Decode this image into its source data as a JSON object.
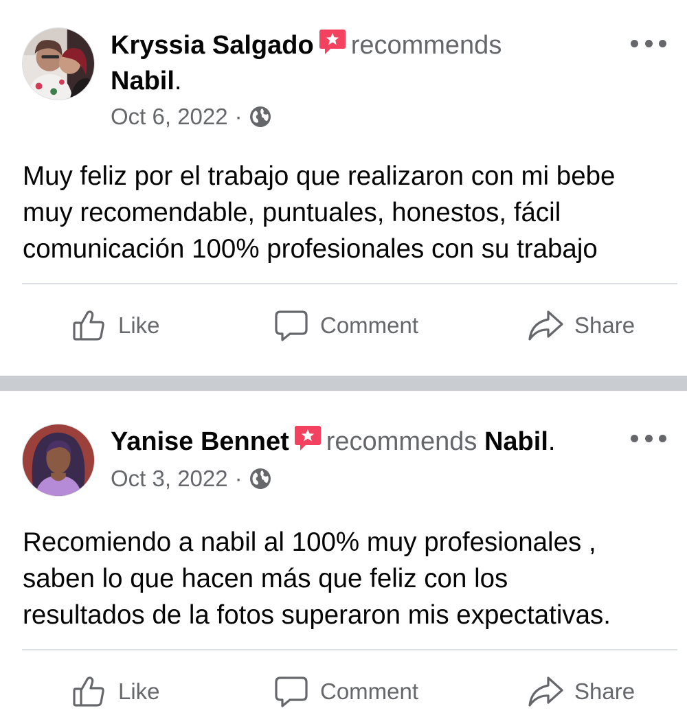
{
  "posts": [
    {
      "author": "Kryssia Salgado",
      "verb": "recommends",
      "page": "Nabil",
      "period": ".",
      "date": "Oct 6, 2022",
      "separator": "·",
      "body": "Muy feliz por el trabajo que realizaron con mi bebe\nmuy recomendable, puntuales, honestos, fácil\ncomunicación 100% profesionales con su trabajo",
      "actions": {
        "like": "Like",
        "comment": "Comment",
        "share": "Share"
      }
    },
    {
      "author": "Yanise Bennet",
      "verb": "recommends",
      "page": "Nabil",
      "period": ".",
      "date": "Oct 3, 2022",
      "separator": "·",
      "body": "Recomiendo a nabil al 100% muy profesionales ,\nsaben lo que hacen más que feliz con los\nresultados de la fotos superaron mis expectativas.",
      "actions": {
        "like": "Like",
        "comment": "Comment",
        "share": "Share"
      }
    }
  ],
  "icons": {
    "badge": "recommendation-badge-icon",
    "audience": "globe-icon",
    "more": "more-options-icon",
    "like": "thumbs-up-icon",
    "comment": "comment-bubble-icon",
    "share": "share-arrow-icon"
  },
  "colors": {
    "text_primary": "#050505",
    "text_secondary": "#65676b",
    "badge": "#f3425f",
    "separator": "#c9ccd1",
    "divider": "#dadde1"
  }
}
